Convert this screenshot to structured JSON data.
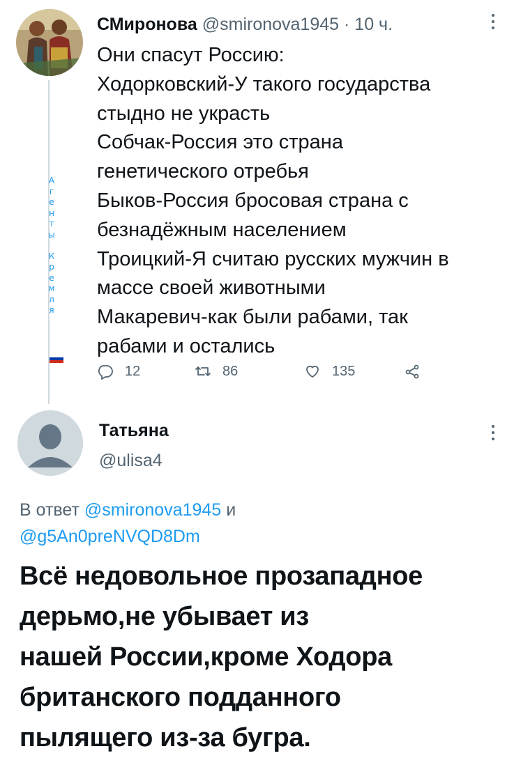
{
  "tweet1": {
    "author_name": "СМиронова",
    "handle": "@smironova1945",
    "separator": "·",
    "time": "10 ч.",
    "profile_letters": [
      "А",
      "г",
      "е",
      "н",
      "т",
      "ы",
      "",
      "К",
      "р",
      "е",
      "м",
      "л",
      "я"
    ],
    "body_lines": [
      "Они спасут Россию:",
      "Ходорковский-У такого государства",
      "стыдно не украсть",
      "Собчак-Россия это страна",
      "генетического отребья",
      "Быков-Россия бросовая страна с",
      "безнадёжным населением",
      "Троицкий-Я считаю русских мужчин в",
      "массе своей животными",
      "Макаревич-как были рабами, так",
      "рабами и остались"
    ],
    "actions": {
      "reply_count": "12",
      "retweet_count": "86",
      "like_count": "135"
    }
  },
  "tweet2": {
    "author_name": "Татьяна",
    "handle": "@ulisa4",
    "reply_prefix": "В ответ",
    "reply_user1": "@smironova1945",
    "reply_joiner": "и",
    "reply_user2": "@g5An0preNVQD8Dm",
    "body_lines": [
      "Всё недовольное прозападное",
      "дерьмо,не убывает из",
      "нашей России,кроме Ходора",
      "британского подданного",
      "пылящего из-за бугра."
    ]
  },
  "colors": {
    "text_primary": "#0f1419",
    "text_secondary": "#536471",
    "link": "#1d9bf0",
    "thread_line": "#cfd9de"
  },
  "icons": [
    "reply-icon",
    "retweet-icon",
    "like-icon",
    "share-icon",
    "more-icon",
    "flag-icon",
    "default-avatar-icon"
  ]
}
